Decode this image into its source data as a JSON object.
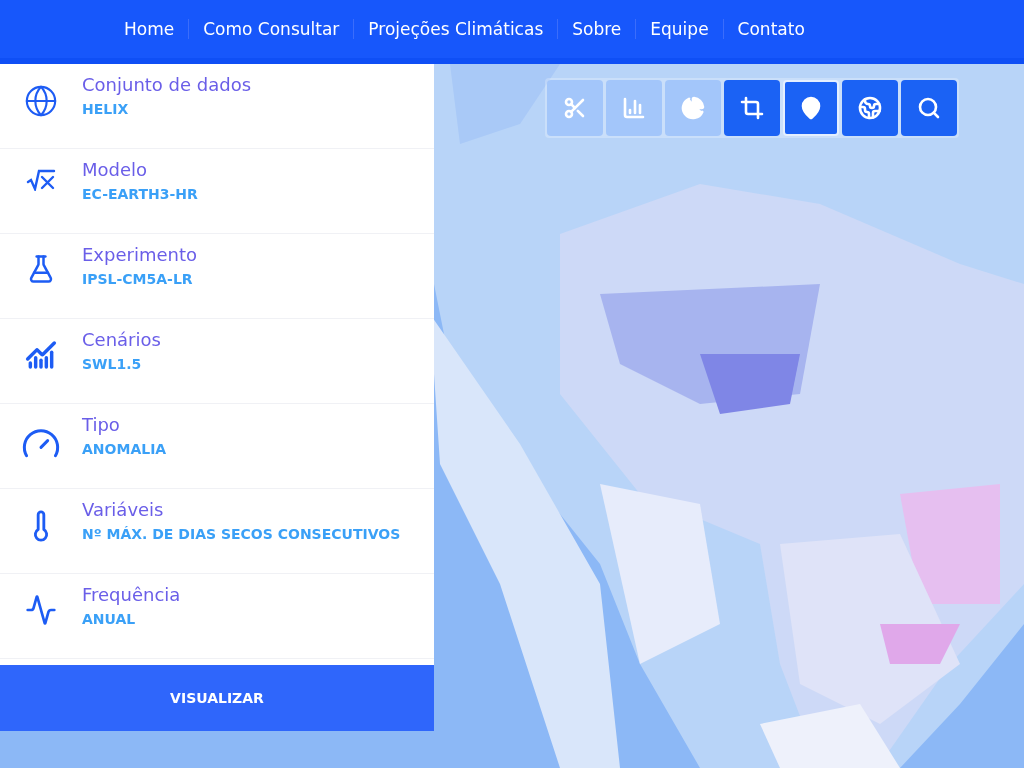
{
  "nav": [
    {
      "label": "Home"
    },
    {
      "label": "Como Consultar"
    },
    {
      "label": "Projeções Climáticas"
    },
    {
      "label": "Sobre"
    },
    {
      "label": "Equipe"
    },
    {
      "label": "Contato"
    }
  ],
  "filters": [
    {
      "label": "Conjunto de dados",
      "value": "HELIX"
    },
    {
      "label": "Modelo",
      "value": "EC-EARTH3-HR"
    },
    {
      "label": "Experimento",
      "value": "IPSL-CM5A-LR"
    },
    {
      "label": "Cenários",
      "value": "SWL1.5"
    },
    {
      "label": "Tipo",
      "value": "ANOMALIA"
    },
    {
      "label": "Variáveis",
      "value": "Nº MÁX. DE DIAS SECOS CONSECUTIVOS"
    },
    {
      "label": "Frequência",
      "value": "ANUAL"
    }
  ],
  "visualize_button": "VISUALIZAR",
  "map_tools": [
    {
      "disabled": true,
      "selected": false
    },
    {
      "disabled": true,
      "selected": false
    },
    {
      "disabled": true,
      "selected": false
    },
    {
      "disabled": false,
      "selected": false
    },
    {
      "disabled": false,
      "selected": true
    },
    {
      "disabled": false,
      "selected": false
    },
    {
      "disabled": false,
      "selected": false
    }
  ]
}
